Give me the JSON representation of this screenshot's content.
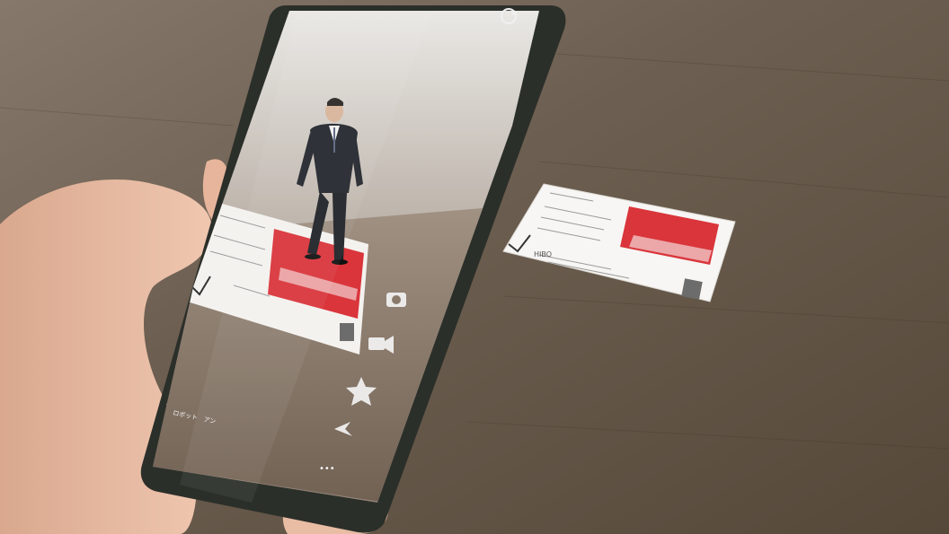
{
  "photo": {
    "subject": "smartphone showing AR business card",
    "colors": {
      "table": "#6a5a4c",
      "card_red": "#d9353b",
      "phone_frame": "#2b2f2a",
      "hand": "#e8b9a0"
    }
  },
  "phone_ui": {
    "sync_icon": "sync-icon",
    "camera_icon": "camera-icon",
    "video_icon": "video-icon",
    "star_icon": "star-icon",
    "share_icon": "share-icon",
    "more_label": "•••",
    "bottom_left_text": "ロボット　アン",
    "bottom_left_icon": "app-icon"
  },
  "card": {
    "logo_text": "HIBO"
  }
}
